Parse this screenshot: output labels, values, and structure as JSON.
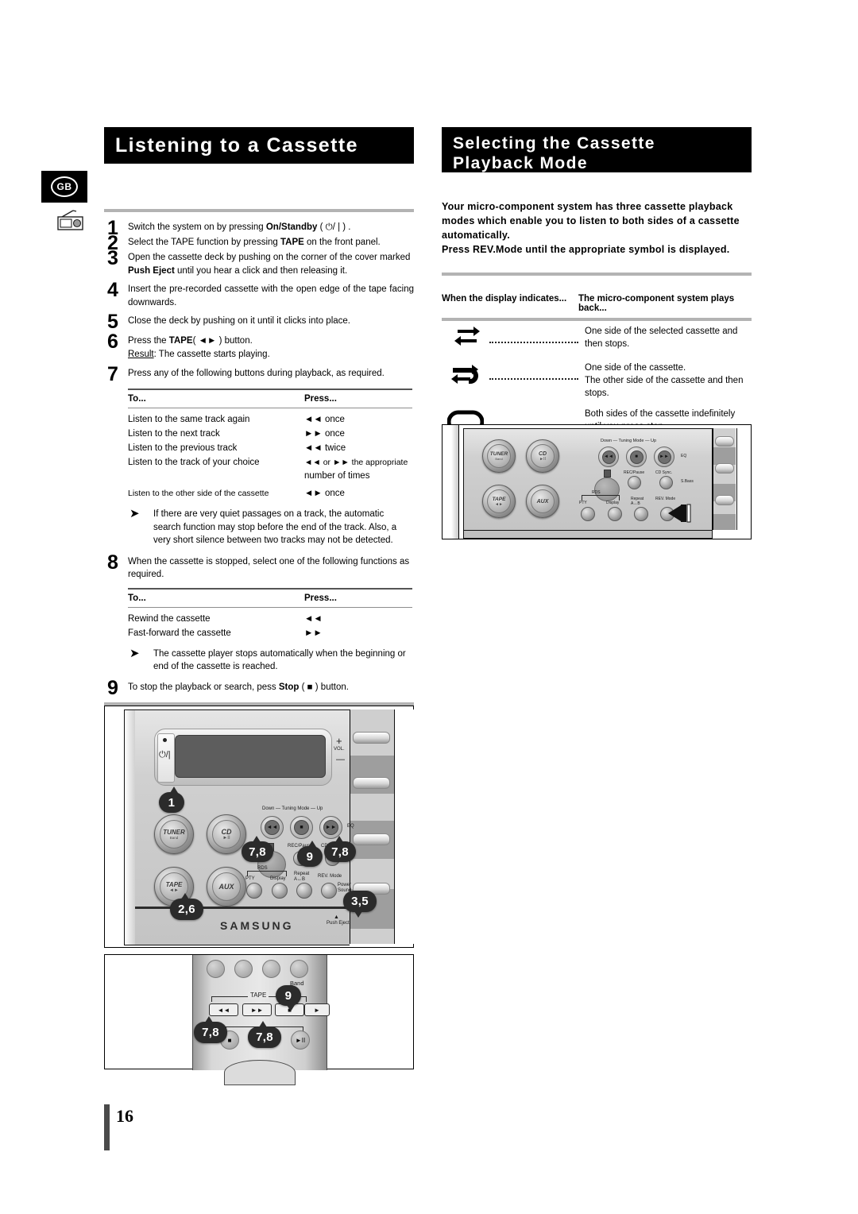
{
  "locale_badge": "GB",
  "page_number": "16",
  "left": {
    "title": "Listening to a Cassette",
    "steps": [
      {
        "num": "1",
        "html": "Switch the system on by pressing <b>On/Standby</b> ( ⏻/ | ) ."
      },
      {
        "num": "2",
        "html": "Select the TAPE function by pressing <b>TAPE</b> on the front panel."
      },
      {
        "num": "3",
        "html": "Open the cassette deck by pushing on the corner of the cover marked <b>Push Eject</b> until you hear a click and then releasing it."
      },
      {
        "num": "4",
        "html": "Insert the pre-recorded cassette with the open edge of the tape facing downwards."
      },
      {
        "num": "5",
        "html": "Close the deck by pushing on it until it clicks into place."
      },
      {
        "num": "6",
        "html": "Press the <b>TAPE</b>( ◄► ) button.<br><u>Result</u>: The cassette starts playing."
      },
      {
        "num": "7",
        "html": "Press any of the following buttons during playback, as required."
      }
    ],
    "table1": {
      "header": {
        "to": "To...",
        "press": "Press..."
      },
      "rows": [
        {
          "to": "Listen to the same track again",
          "press": "◄◄  once"
        },
        {
          "to": "Listen to the next track",
          "press": "►►  once"
        },
        {
          "to": "Listen to the previous track",
          "press": "◄◄  twice"
        },
        {
          "to": "Listen to the track of your choice",
          "press": "◄◄  or  ►►   the appropriate"
        },
        {
          "to": "",
          "press": "number of times"
        },
        {
          "to": "Listen to the other side of the cassette",
          "press": "◄►  once"
        }
      ]
    },
    "note1": "If there are very quiet passages on a track, the automatic search function may stop before the end of the track. Also, a very short silence between two tracks may not be detected.",
    "step8": {
      "num": "8",
      "html": "When the cassette is stopped, select one of the following functions as required."
    },
    "table2": {
      "header": {
        "to": "To...",
        "press": "Press..."
      },
      "rows": [
        {
          "to": "Rewind the cassette",
          "press": "◄◄"
        },
        {
          "to": "Fast-forward the cassette",
          "press": "►►"
        }
      ]
    },
    "note2": "The cassette player stops automatically when the beginning or end of the cassette is reached.",
    "step9": {
      "num": "9",
      "html": "To stop the playback or search, pess <b>Stop</b> ( ■ ) button."
    }
  },
  "right": {
    "title_line1": "Selecting the Cassette",
    "title_line2": "Playback Mode",
    "intro": "Your micro-component system has three cassette playback modes which enable you to listen to both sides of a cassette automatically.\nPress REV.Mode until the appropriate symbol is displayed.",
    "intro_lines": [
      "Your micro-component system has three cassette playback",
      "modes which enable you to listen to both sides of a cassette",
      "automatically.",
      "Press REV.Mode until the appropriate symbol is displayed."
    ],
    "mode_table": {
      "header": {
        "col1": "When the display indicates...",
        "col2": "The micro-component system plays back..."
      },
      "rows": [
        {
          "symbol": "one-way-arrows-icon",
          "text": "One side of the selected cassette and then stops."
        },
        {
          "symbol": "half-loop-arrow-icon",
          "text": "One side of the cassette.\nThe other side of the cassette and then stops."
        },
        {
          "symbol": "full-loop-arrow-icon",
          "text": "Both sides of the cassette indefinitely until you press stop."
        }
      ]
    }
  },
  "illustrations": {
    "front_panel": {
      "knobs": [
        {
          "label": "TUNER",
          "sub": "Band"
        },
        {
          "label": "CD",
          "sub": "►II"
        },
        {
          "label": "TAPE",
          "sub": "◄►"
        },
        {
          "label": "AUX",
          "sub": ""
        }
      ],
      "tuning_label": "Down —  Tuning Mode  — Up",
      "labels": [
        "REC/Pause",
        "CD Sync.",
        "PTY",
        "Display",
        "Repeat",
        "A↔B",
        "REV. Mode",
        "RDS",
        "EQ",
        "S.Bass",
        "Power Sound",
        "Push Eject",
        "VOL.",
        "+",
        "—"
      ],
      "brand": "SAMSUNG"
    },
    "remote": {
      "tape_label": "TAPE",
      "band_label": "Band",
      "buttons": [
        "◄◄",
        "►►",
        "■",
        "►",
        "■",
        "►II"
      ]
    },
    "callouts_front_big": [
      "1",
      "7,8",
      "9",
      "7,8",
      "2,6",
      "3,5"
    ],
    "callouts_remote": [
      "9",
      "7,8",
      "7,8"
    ]
  }
}
